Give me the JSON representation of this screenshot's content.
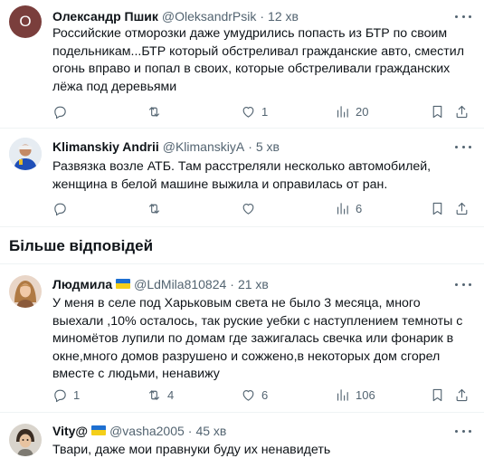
{
  "tweets": [
    {
      "avatar_letter": "O",
      "name": "Олександр Пшик",
      "handle": "@OleksandrPsik",
      "time": "12 хв",
      "text": "Российские отморозки даже умудрились попасть из БТР по своим подельникам...БТР который обстреливал гражданские авто, сместил огонь вправо и попал в своих, которые обстреливали гражданских лёжа под деревьями",
      "replies": "",
      "retweets": "",
      "likes": "1",
      "views": "20"
    },
    {
      "name": "Klimanskiy Andrii",
      "handle": "@KlimanskiyA",
      "time": "5 хв",
      "text": "Развязка возле АТБ. Там расстреляли несколько автомобилей, женщина в белой машине выжила и оправилась от ран.",
      "replies": "",
      "retweets": "",
      "likes": "",
      "views": "6"
    },
    {
      "name": "Людмила",
      "handle": "@LdMila810824",
      "time": "21 хв",
      "text": "У меня в селе под Харьковым света не было 3 месяца, много выехали ,10% осталось, так руские уебки с наступлением темноты с миномётов лупили по домам где зажигалась свечка или фонарик в окне,много домов разрушено и сожжено,в некоторых дом сгорел вместе с людьми, ненавижу",
      "replies": "1",
      "retweets": "4",
      "likes": "6",
      "views": "106"
    },
    {
      "name": "Vity@",
      "handle": "@vasha2005",
      "time": "45 хв",
      "text": "Твари, даже мои правнуки буду их ненавидеть"
    }
  ],
  "section_title": "Більше відповідей",
  "separator": "·",
  "icons": {
    "reply": "reply-icon",
    "retweet": "retweet-icon",
    "like": "like-icon",
    "views": "views-icon",
    "bookmark": "bookmark-icon",
    "share": "share-icon",
    "more": "more-icon",
    "flag": "ukraine-flag-icon"
  },
  "colors": {
    "text": "#0f1419",
    "muted": "#536471",
    "divider": "#eff3f4",
    "flag_blue": "#1d6fd1",
    "flag_yellow": "#f4cf1a"
  }
}
